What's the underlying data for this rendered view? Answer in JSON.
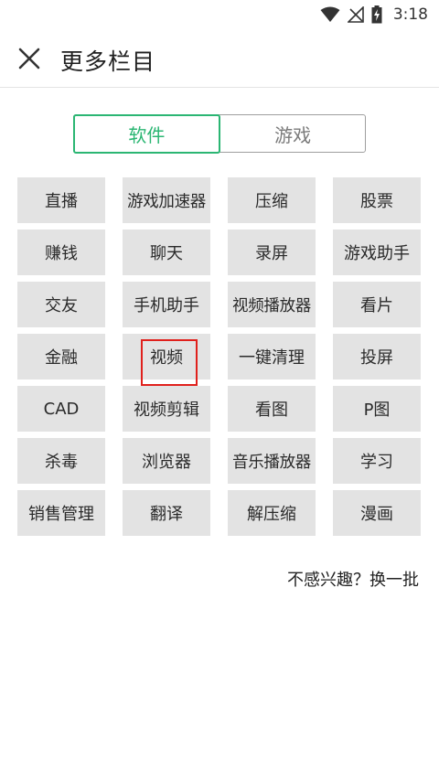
{
  "status_bar": {
    "time": "3:18",
    "icons": [
      "wifi-icon",
      "no-signal-icon",
      "battery-charging-icon"
    ]
  },
  "header": {
    "close_icon": "close-icon",
    "title": "更多栏目"
  },
  "tabs": [
    {
      "label": "软件",
      "active": true
    },
    {
      "label": "游戏",
      "active": false
    }
  ],
  "colors": {
    "accent": "#2bb673",
    "cell_bg": "#e3e3e3",
    "highlight": "#e0201c"
  },
  "categories": [
    "直播",
    "游戏加速器",
    "压缩",
    "股票",
    "赚钱",
    "聊天",
    "录屏",
    "游戏助手",
    "交友",
    "手机助手",
    "视频播放器",
    "看片",
    "金融",
    "视频",
    "一键清理",
    "投屏",
    "CAD",
    "视频剪辑",
    "看图",
    "P图",
    "杀毒",
    "浏览器",
    "音乐播放器",
    "学习",
    "销售管理",
    "翻译",
    "解压缩",
    "漫画"
  ],
  "footer": {
    "refresh_label": "不感兴趣？换一批"
  }
}
